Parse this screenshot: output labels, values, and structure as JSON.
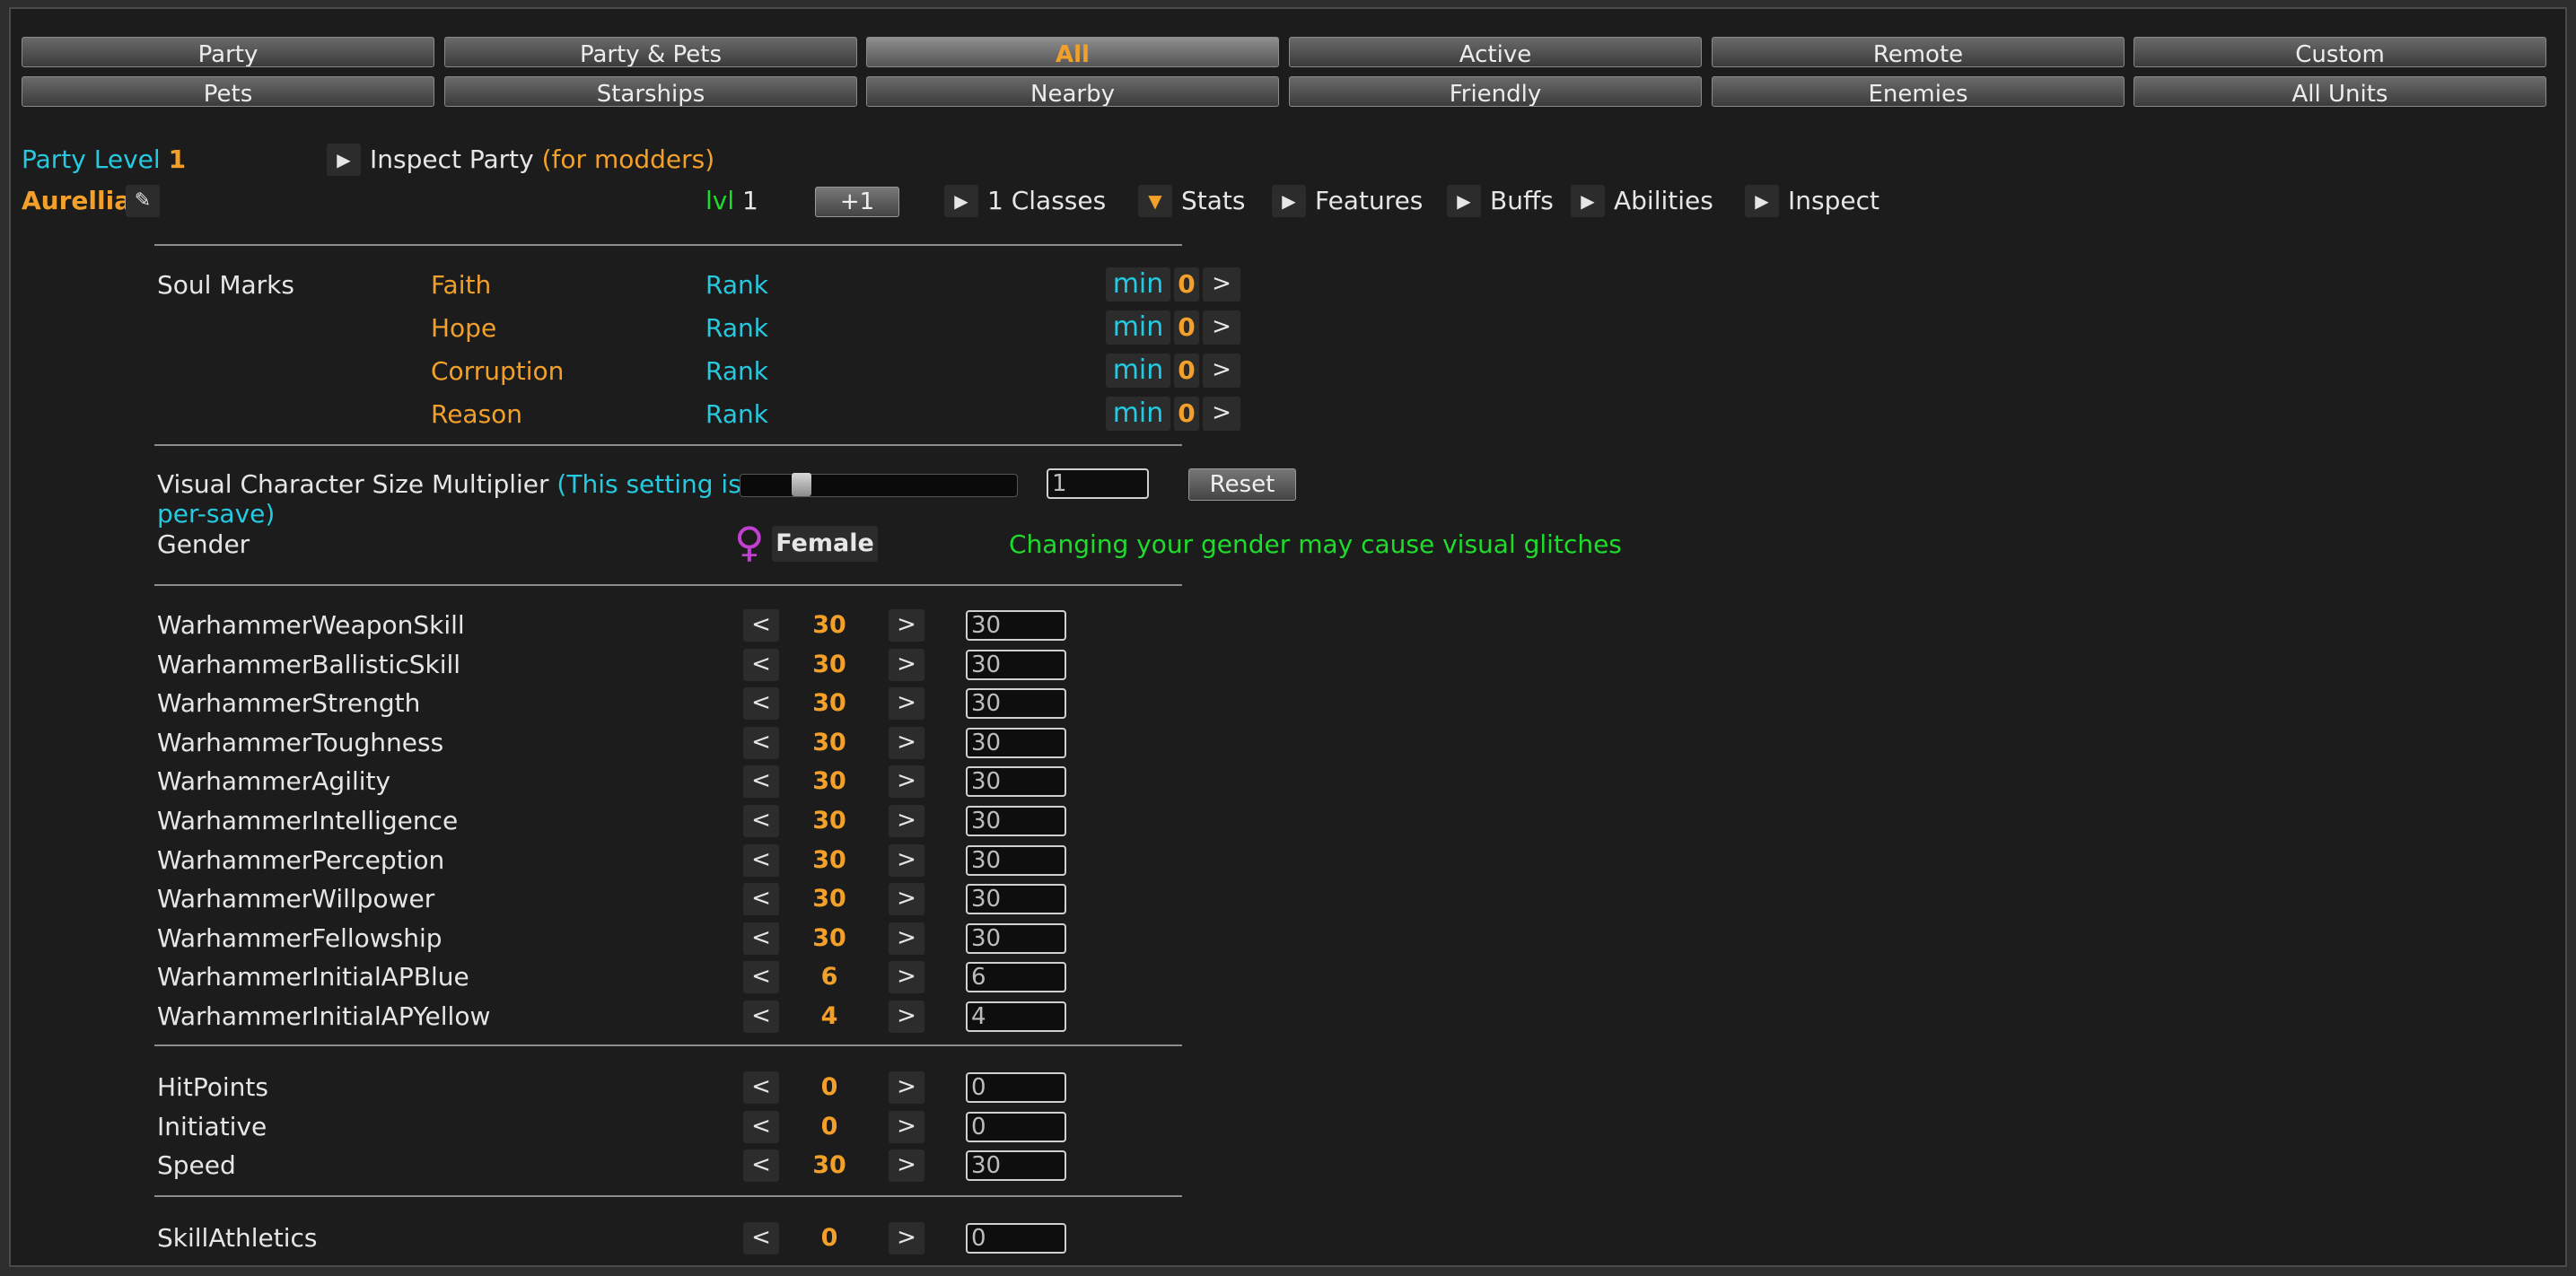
{
  "tabs_row1": [
    "Party",
    "Party & Pets",
    "All",
    "Active",
    "Remote",
    "Custom"
  ],
  "tabs_row2": [
    "Pets",
    "Starships",
    "Nearby",
    "Friendly",
    "Enemies",
    "All Units"
  ],
  "active_tab": "All",
  "party": {
    "level_label": "Party Level",
    "level_value": "1",
    "inspect_label": "Inspect Party",
    "inspect_note": "(for modders)"
  },
  "character": {
    "name": "Aurellia",
    "lvl_label": "lvl",
    "lvl_value": "1",
    "plus_one": "+1",
    "toggles": {
      "classes": "1 Classes",
      "stats": "Stats",
      "features": "Features",
      "buffs": "Buffs",
      "abilities": "Abilities",
      "inspect": "Inspect"
    }
  },
  "soul_marks": {
    "label": "Soul Marks",
    "rank_label": "Rank",
    "min_label": "min",
    "next_label": ">",
    "items": [
      {
        "name": "Faith",
        "value": "0"
      },
      {
        "name": "Hope",
        "value": "0"
      },
      {
        "name": "Corruption",
        "value": "0"
      },
      {
        "name": "Reason",
        "value": "0"
      }
    ]
  },
  "size_setting": {
    "label": "Visual Character Size Multiplier",
    "note_line1": "(This setting is",
    "note_line2": "per-save)",
    "slider_fraction": 0.2,
    "value": "1",
    "reset_label": "Reset"
  },
  "gender": {
    "label": "Gender",
    "symbol": "♀",
    "value": "Female",
    "warning": "Changing your gender may cause visual glitches"
  },
  "stepper": {
    "dec": "<",
    "inc": ">"
  },
  "stats": [
    {
      "name": "WarhammerWeaponSkill",
      "value": "30"
    },
    {
      "name": "WarhammerBallisticSkill",
      "value": "30"
    },
    {
      "name": "WarhammerStrength",
      "value": "30"
    },
    {
      "name": "WarhammerToughness",
      "value": "30"
    },
    {
      "name": "WarhammerAgility",
      "value": "30"
    },
    {
      "name": "WarhammerIntelligence",
      "value": "30"
    },
    {
      "name": "WarhammerPerception",
      "value": "30"
    },
    {
      "name": "WarhammerWillpower",
      "value": "30"
    },
    {
      "name": "WarhammerFellowship",
      "value": "30"
    },
    {
      "name": "WarhammerInitialAPBlue",
      "value": "6"
    },
    {
      "name": "WarhammerInitialAPYellow",
      "value": "4"
    }
  ],
  "derived_stats": [
    {
      "name": "HitPoints",
      "value": "0"
    },
    {
      "name": "Initiative",
      "value": "0"
    },
    {
      "name": "Speed",
      "value": "30"
    }
  ],
  "skills": [
    {
      "name": "SkillAthletics",
      "value": "0"
    }
  ],
  "colors": {
    "accent_orange": "#f2a02a",
    "accent_cyan": "#25c9e0",
    "warning_green": "#1fdc2c",
    "gender_purple": "#c040d0",
    "background": "#1c1c1c"
  }
}
